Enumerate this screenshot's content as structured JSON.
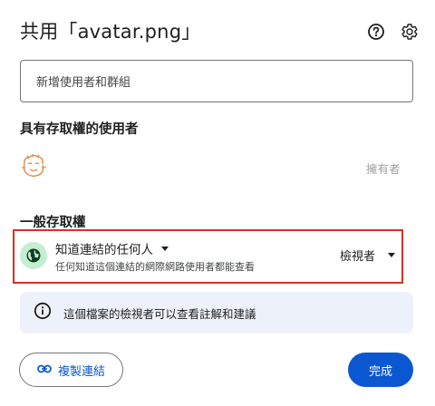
{
  "dialog": {
    "title": "共用「avatar.png」",
    "help_icon": "help-circle-icon",
    "settings_icon": "gear-icon"
  },
  "add_people": {
    "placeholder": "新增使用者和群組"
  },
  "people_with_access": {
    "heading": "具有存取權的使用者",
    "owner": {
      "avatar": "cartoon-face-avatar",
      "role": "擁有者"
    }
  },
  "general_access": {
    "heading": "一般存取權",
    "icon": "globe-icon",
    "icon_bg": "#c4eed0",
    "type_label": "知道連結的任何人",
    "description": "任何知道這個連結的網際網路使用者都能查看",
    "role_label": "檢視者",
    "highlight_color": "#d93025"
  },
  "info": {
    "icon": "info-icon",
    "text": "這個檔案的檢視者可以查看註解和建議"
  },
  "footer": {
    "copy_link_label": "複製連結",
    "copy_link_icon": "link-icon",
    "done_label": "完成",
    "accent": "#0b57d0"
  }
}
